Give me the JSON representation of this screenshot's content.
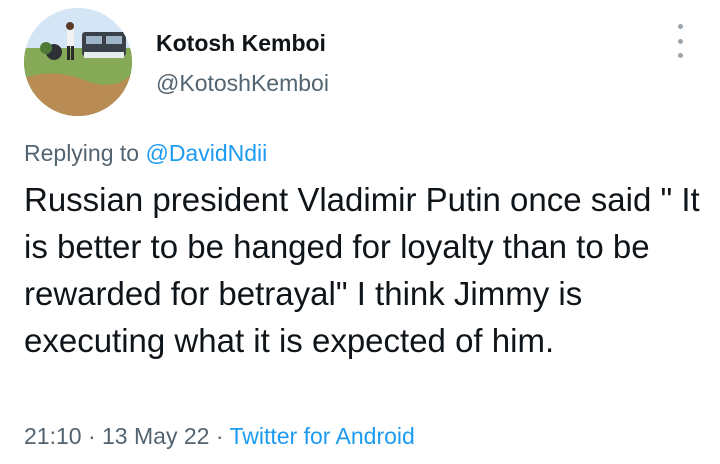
{
  "author": {
    "display_name": "Kotosh Kemboi",
    "handle": "@KotoshKemboi",
    "avatar_icon": "profile-photo"
  },
  "more_icon": "more-vertical-icon",
  "reply": {
    "prefix": "Replying to",
    "mention": "@DavidNdii"
  },
  "tweet": {
    "text": "Russian president Vladimir Putin once said \" It is better to be hanged for loyalty than to be rewarded for betrayal\" I think Jimmy is executing what it is expected of him."
  },
  "meta": {
    "time": "21:10",
    "separator": "·",
    "date": "13 May 22",
    "source": "Twitter for Android"
  },
  "colors": {
    "text": "#0f1419",
    "secondary": "#536471",
    "link": "#1d9bf0"
  }
}
